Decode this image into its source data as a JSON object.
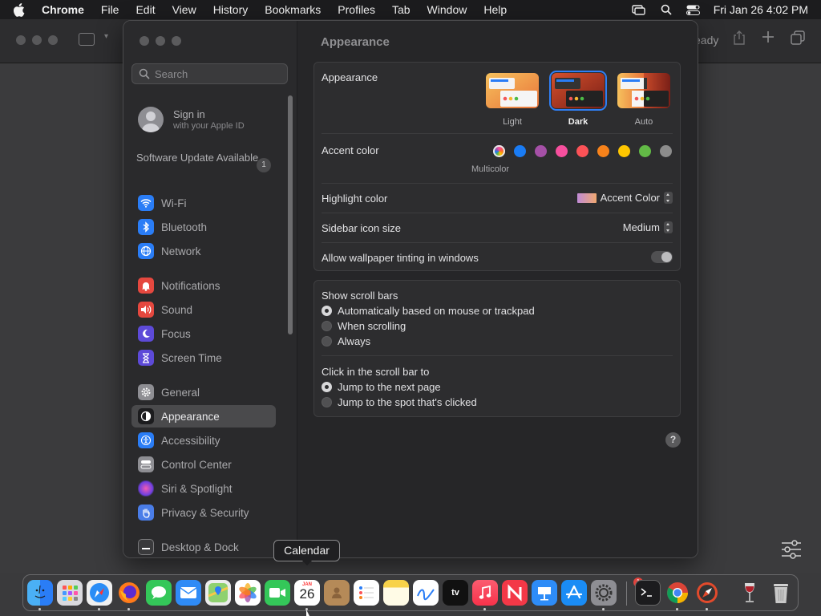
{
  "menubar": {
    "app_name": "Chrome",
    "items": [
      "File",
      "Edit",
      "View",
      "History",
      "Bookmarks",
      "Profiles",
      "Tab",
      "Window",
      "Help"
    ],
    "datetime": "Fri Jan 26  4:02 PM"
  },
  "background_window": {
    "status_text": "eady"
  },
  "settings": {
    "search_placeholder": "Search",
    "signin": {
      "title": "Sign in",
      "subtitle": "with your Apple ID"
    },
    "software_update": {
      "label": "Software Update Available",
      "badge": "1"
    },
    "sidebar_items": [
      {
        "label": "Wi-Fi",
        "color": "#2a7df6",
        "icon": "wifi-icon"
      },
      {
        "label": "Bluetooth",
        "color": "#2a7df6",
        "icon": "bluetooth-icon"
      },
      {
        "label": "Network",
        "color": "#2a7df6",
        "icon": "globe-icon"
      },
      {
        "label": "Notifications",
        "color": "#e5483f",
        "icon": "bell-icon"
      },
      {
        "label": "Sound",
        "color": "#e5483f",
        "icon": "speaker-icon"
      },
      {
        "label": "Focus",
        "color": "#5d4ad8",
        "icon": "moon-icon"
      },
      {
        "label": "Screen Time",
        "color": "#5d4ad8",
        "icon": "hourglass-icon"
      },
      {
        "label": "General",
        "color": "#8e8e93",
        "icon": "gear-icon"
      },
      {
        "label": "Appearance",
        "color": "#1c1c1e",
        "icon": "appearance-icon"
      },
      {
        "label": "Accessibility",
        "color": "#2a7df6",
        "icon": "accessibility-icon"
      },
      {
        "label": "Control Center",
        "color": "#8e8e93",
        "icon": "control-center-icon"
      },
      {
        "label": "Siri & Spotlight",
        "color": "#c04fd8",
        "icon": "siri-icon"
      },
      {
        "label": "Privacy & Security",
        "color": "#4a7de8",
        "icon": "hand-icon"
      },
      {
        "label": "Desktop & Dock",
        "color": "#3a3a3c",
        "icon": "dock-icon"
      }
    ],
    "active_item": "Appearance",
    "title": "Appearance",
    "appearance": {
      "label": "Appearance",
      "options": [
        "Light",
        "Dark",
        "Auto"
      ],
      "selected": "Dark"
    },
    "accent": {
      "label": "Accent color",
      "selected_label": "Multicolor",
      "colors": [
        "multicolor",
        "#1a7cf5",
        "#a550a7",
        "#f74f9e",
        "#fc5257",
        "#f7821b",
        "#ffc600",
        "#62ba46",
        "#8c8c8c"
      ]
    },
    "highlight": {
      "label": "Highlight color",
      "value": "Accent Color"
    },
    "sidebar_icon_size": {
      "label": "Sidebar icon size",
      "value": "Medium"
    },
    "wallpaper_tinting": {
      "label": "Allow wallpaper tinting in windows",
      "on": false
    },
    "scroll_bars": {
      "label": "Show scroll bars",
      "options": [
        "Automatically based on mouse or trackpad",
        "When scrolling",
        "Always"
      ],
      "selected": 0
    },
    "click_scroll": {
      "label": "Click in the scroll bar to",
      "options": [
        "Jump to the next page",
        "Jump to the spot that's clicked"
      ],
      "selected": 0
    },
    "help_label": "?"
  },
  "tooltip": "Calendar",
  "dock": {
    "calendar": {
      "month": "JAN",
      "day": "26"
    },
    "tv_label": "tv",
    "badge": "1"
  }
}
